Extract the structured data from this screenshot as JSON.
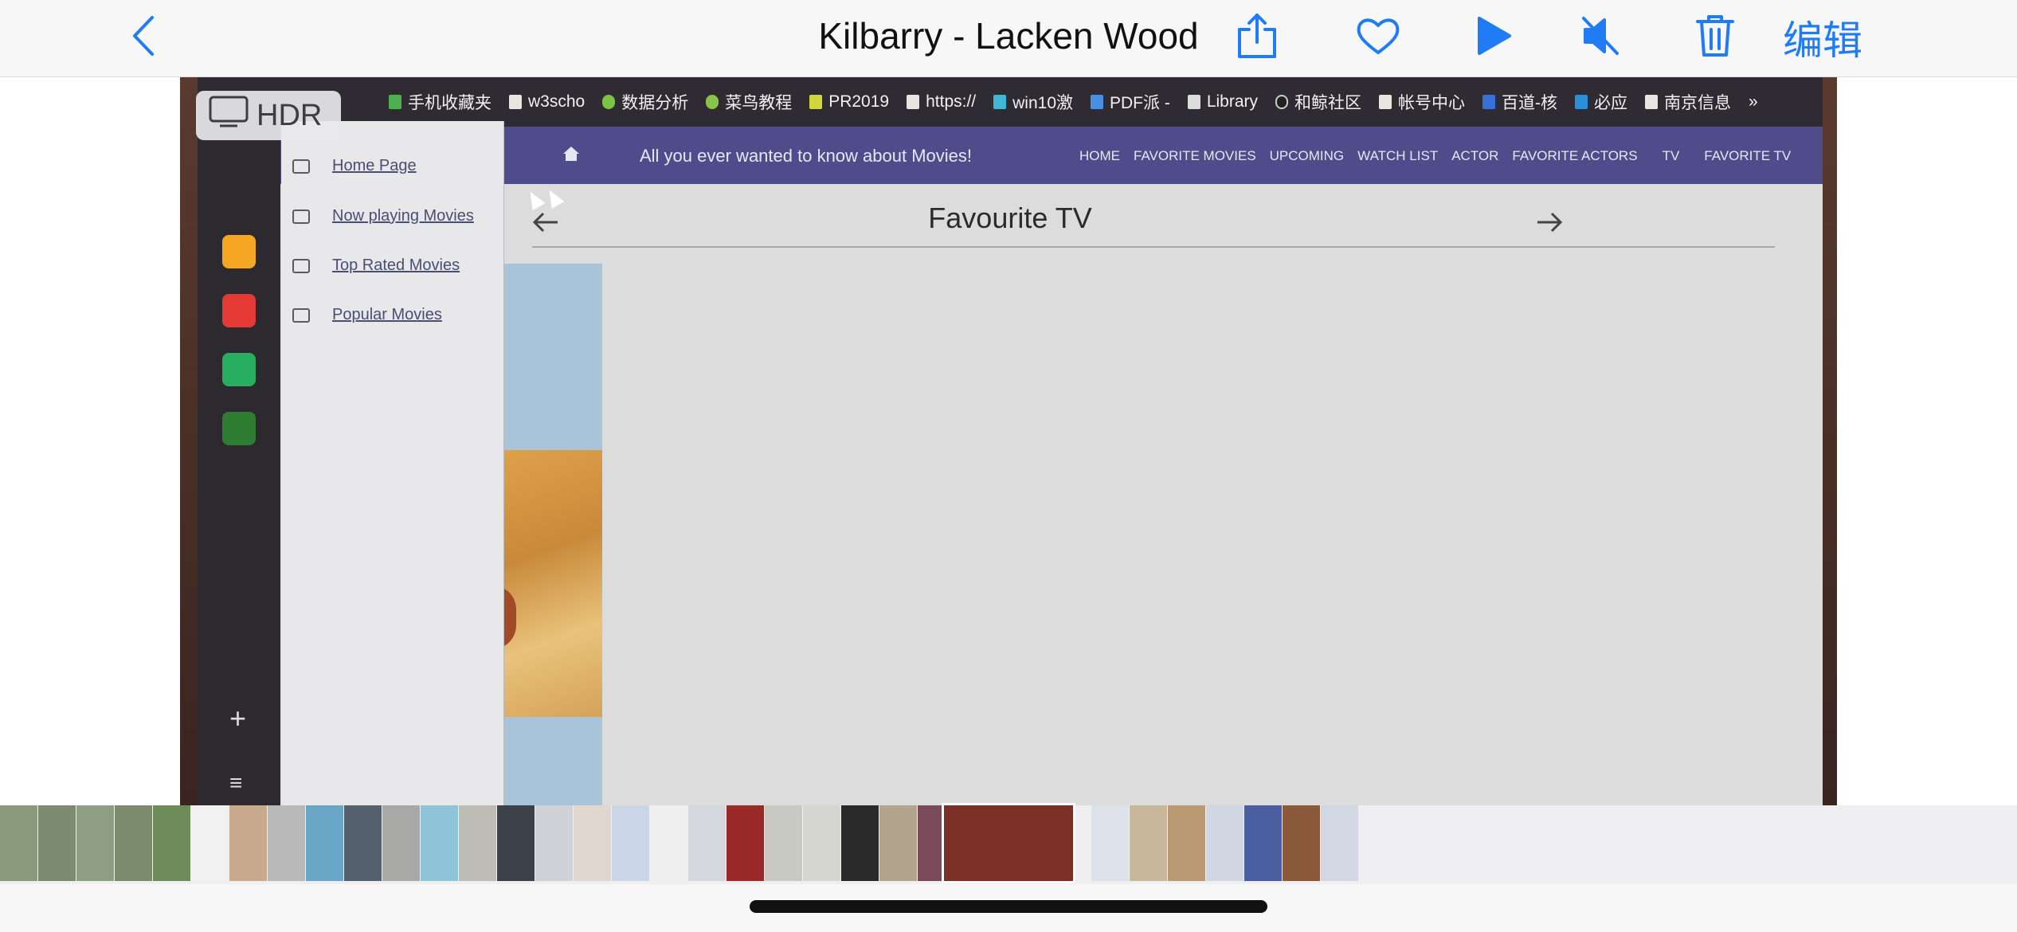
{
  "photos_header": {
    "title": "Kilbarry - Lacken Wood",
    "edit_label": "编辑",
    "buttons": [
      "back-icon",
      "share-icon",
      "heart-icon",
      "play-icon",
      "mute-icon",
      "trash-icon"
    ]
  },
  "hdr_badge": {
    "label": "HDR"
  },
  "bookmarks": {
    "items": [
      "手机收藏夹",
      "w3scho",
      "数据分析",
      "菜鸟教程",
      "PR2019",
      "https://",
      "win10激",
      "PDF派 -",
      "Library",
      "和鲸社区",
      "帐号中心",
      "百道-核",
      "必应",
      "南京信息",
      "»"
    ]
  },
  "site_nav": {
    "tagline": "All you ever wanted to know about Movies!",
    "links": [
      "HOME",
      "FAVORITE MOVIES",
      "UPCOMING",
      "WATCH LIST",
      "ACTOR",
      "FAVORITE ACTORS",
      "TV",
      "FAVORITE TV"
    ]
  },
  "page": {
    "title": "Favourite TV"
  },
  "side_menu": {
    "items": [
      "Home Page",
      "Now playing Movies",
      "Top Rated Movies",
      "Popular Movies"
    ]
  },
  "dock": {
    "plus": "+",
    "list": "≡"
  },
  "colors": {
    "accent": "#1f7cf5",
    "site_nav": "#4e4c8b",
    "bookmark_bar": "#2f2b32"
  }
}
